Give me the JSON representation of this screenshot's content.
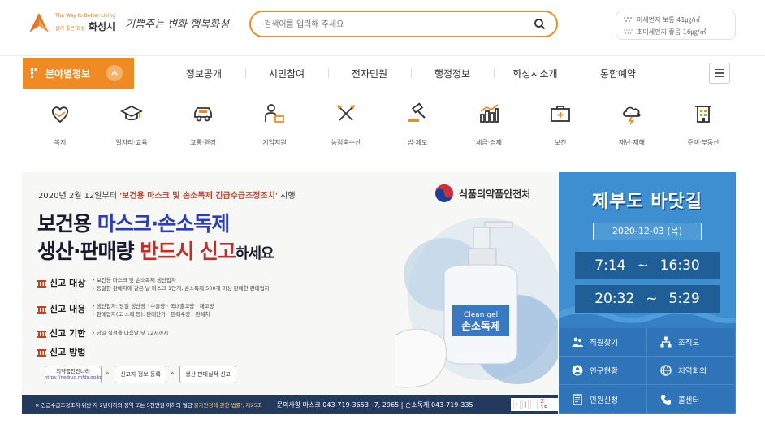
{
  "header": {
    "logo_tagline": "The Way to Better Living",
    "logo_small": "살기 좋은 화성",
    "logo_city": "화성시",
    "logo_slogan": "기쁨주는 변화 행복화성",
    "search_placeholder": "검색어를 입력해 주세요",
    "dust": [
      {
        "label": "미세먼지 보통 41㎍/㎥"
      },
      {
        "label": "초미세먼지 좋음 16㎍/㎥"
      }
    ]
  },
  "nav": {
    "category_label": "분야별정보",
    "items": [
      "정보공개",
      "시민참여",
      "전자민원",
      "행정정보",
      "화성시소개",
      "통합예약"
    ]
  },
  "categories": [
    {
      "label": "복지",
      "icon": "welfare-icon"
    },
    {
      "label": "일자리·교육",
      "icon": "graduation-cap-icon"
    },
    {
      "label": "교통·환경",
      "icon": "car-icon"
    },
    {
      "label": "기업지원",
      "icon": "business-person-icon"
    },
    {
      "label": "농림축수산",
      "icon": "farm-tools-icon"
    },
    {
      "label": "법·제도",
      "icon": "gavel-icon"
    },
    {
      "label": "세금·경제",
      "icon": "bar-chart-icon"
    },
    {
      "label": "보건",
      "icon": "medical-kit-icon"
    },
    {
      "label": "재난·재해",
      "icon": "storm-icon"
    },
    {
      "label": "주택·부동산",
      "icon": "building-icon"
    }
  ],
  "banner": {
    "top_prefix": "2020년 2월 12일부터 ",
    "top_emph": "'보건용 마스크 및 손소독제 긴급수급조정조치'",
    "top_suffix": " 시행",
    "agency": "식품의약품안전처",
    "h1_a": "보건용 ",
    "h1_b": "마스크·손소독제",
    "h2_a": "생산·판매량 ",
    "h2_b": "반드시 신고",
    "h2_c": "하세요",
    "sections": [
      {
        "title": "신고 대상",
        "desc": [
          "• 보건용 마스크 및 손소독제 생산업자",
          "• 동일한 판매처에 같은 날 마스크 1만개, 손소독제 500개 이상 판매한 판매업자"
        ]
      },
      {
        "title": "신고 내용",
        "desc": [
          "• 생산업자: 당일 생산량 · 수출량 · 국내출고량 · 재고량",
          "• 판매업자(도·소매 등): 판매단가 · 판매수량 · 판매처"
        ]
      },
      {
        "title": "신고 기한",
        "desc": [
          "• 당일 실적을 다음날 낮 12시까지"
        ]
      },
      {
        "title": "신고 방법",
        "desc": []
      }
    ],
    "steps": {
      "site_name": "의약품안전나라",
      "site_url": "https://nedrug.mfds.go.kr",
      "step2": "신고자 정보 등록",
      "step3": "생산·판매실적 신고"
    },
    "bottle_label_top": "Clean gel",
    "bottle_label": "손소독제",
    "footer_note_a": "※ 긴급수급조정조치 위반 자 2년이하의 징역 또는 5천만원 이하의 벌금 ",
    "footer_note_b": "'물가안정에 관한 법률', 제25조",
    "footer_call": "문의사항  마스크 043-719-3653~7, 2965 | 손소독제 043-719-335",
    "pager_current": "2",
    "pager_total": "19"
  },
  "tide": {
    "title": "제부도 바닷길",
    "date": "2020-12-03 (목)",
    "rows": [
      {
        "from": "7:14",
        "sep": "~",
        "to": "16:30"
      },
      {
        "from": "20:32",
        "sep": "~",
        "to": "5:29"
      }
    ]
  },
  "quick_links": [
    {
      "label": "직원찾기",
      "icon": "people-icon"
    },
    {
      "label": "조직도",
      "icon": "org-chart-icon"
    },
    {
      "label": "인구현황",
      "icon": "person-circle-icon"
    },
    {
      "label": "지역회의",
      "icon": "globe-icon"
    },
    {
      "label": "민원신청",
      "icon": "document-icon"
    },
    {
      "label": "콜센터",
      "icon": "phone-icon"
    }
  ],
  "colors": {
    "accent": "#f08a24",
    "banner_footer": "#233a5e",
    "tide_bg": "#3d8fd1",
    "quick_bg": "#2f73b8"
  }
}
